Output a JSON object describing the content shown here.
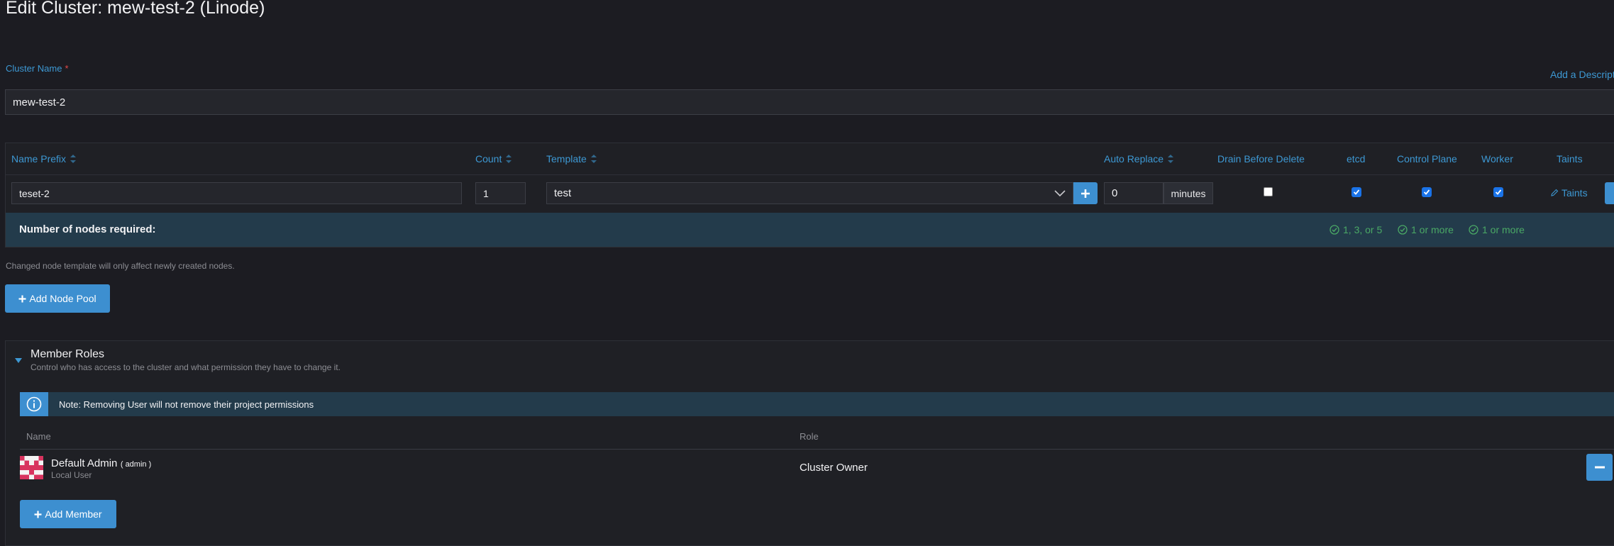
{
  "page": {
    "title": "Edit Cluster: mew-test-2 (Linode)"
  },
  "cluster_name": {
    "label": "Cluster Name",
    "required_mark": "*",
    "value": "mew-test-2",
    "add_description": "Add a Descript"
  },
  "node_pool": {
    "headers": {
      "name_prefix": "Name Prefix",
      "count": "Count",
      "template": "Template",
      "auto_replace": "Auto Replace",
      "drain": "Drain Before Delete",
      "etcd": "etcd",
      "control_plane": "Control Plane",
      "worker": "Worker",
      "taints": "Taints"
    },
    "row": {
      "name_prefix": "teset-2",
      "count": "1",
      "template": "test",
      "auto_replace": "0",
      "auto_replace_unit": "minutes",
      "drain": false,
      "etcd": true,
      "control_plane": true,
      "worker": true,
      "taints_label": "Taints"
    },
    "requirements": {
      "label": "Number of nodes required:",
      "etcd": "1, 3, or 5",
      "control_plane": "1 or more",
      "worker": "1 or more"
    }
  },
  "notes": {
    "template_change": "Changed node template will only affect newly created nodes."
  },
  "buttons": {
    "add_node_pool": "Add Node Pool",
    "add_member": "Add Member"
  },
  "member_roles": {
    "title": "Member Roles",
    "subtitle": "Control who has access to the cluster and what permission they have to change it.",
    "banner": "Note: Removing User will not remove their project permissions",
    "columns": {
      "name": "Name",
      "role": "Role"
    },
    "members": [
      {
        "name": "Default Admin",
        "username": "( admin )",
        "source": "Local User",
        "role": "Cluster Owner"
      }
    ]
  },
  "colors": {
    "accent": "#3d98d3",
    "banner": "#233b4b",
    "success": "#4aa865",
    "danger": "#e24a4a"
  }
}
